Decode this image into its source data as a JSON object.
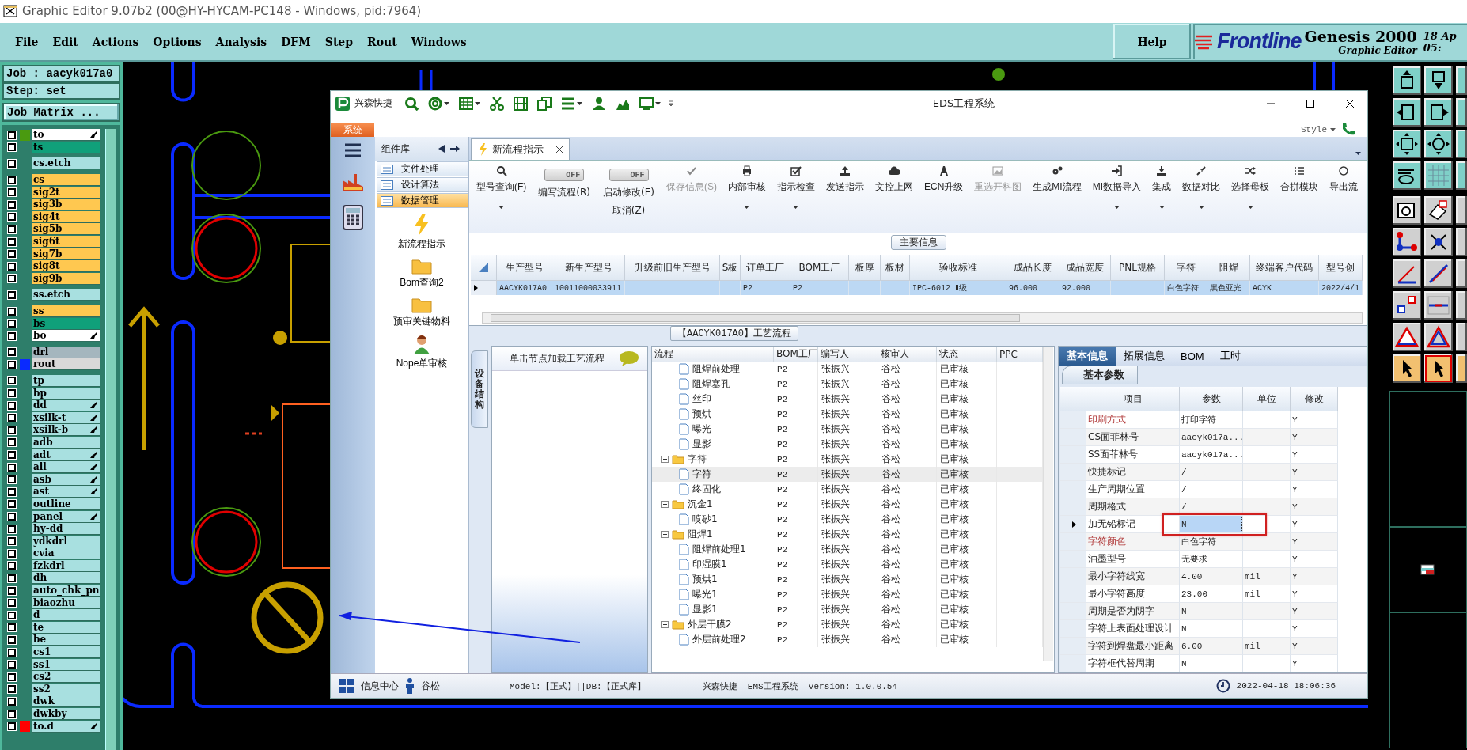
{
  "window": {
    "title": "Graphic Editor 9.07b2 (00@HY-HYCAM-PC148 - Windows, pid:7964)"
  },
  "menu": [
    {
      "label": "File"
    },
    {
      "label": "Edit"
    },
    {
      "label": "Actions"
    },
    {
      "label": "Options"
    },
    {
      "label": "Analysis"
    },
    {
      "label": "DFM"
    },
    {
      "label": "Step"
    },
    {
      "label": "Rout"
    },
    {
      "label": "Windows"
    }
  ],
  "help": "Help",
  "brand": {
    "logo": "Frontline",
    "product": "Genesis 2000",
    "subtitle": "Graphic Editor",
    "date": "18 Ap",
    "time": "05:"
  },
  "job": {
    "job": "Job : aacyk017a0",
    "step": "Step: set",
    "matrix_button": "Job Matrix ..."
  },
  "layer_groups": [
    {
      "layers": [
        {
          "name": "to",
          "color": "#ffffff",
          "swatch": {
            "color": "#4a9a10"
          },
          "pointer": true,
          "checked": false
        },
        {
          "name": "ts",
          "color": "#10a07a",
          "pointer": false,
          "checked": false
        }
      ]
    },
    {
      "layers": [
        {
          "name": "cs.etch",
          "color": "#a8e0e0",
          "pointer": false,
          "checked": false
        }
      ]
    },
    {
      "layers": [
        {
          "name": "cs",
          "color": "#ffc850",
          "pointer": false,
          "checked": false
        },
        {
          "name": "sig2t",
          "color": "#ffc850",
          "pointer": false,
          "checked": false
        },
        {
          "name": "sig3b",
          "color": "#ffc850",
          "pointer": false,
          "checked": false
        },
        {
          "name": "sig4t",
          "color": "#ffc850",
          "pointer": false,
          "checked": false
        },
        {
          "name": "sig5b",
          "color": "#ffc850",
          "pointer": false,
          "checked": false
        },
        {
          "name": "sig6t",
          "color": "#ffc850",
          "pointer": false,
          "checked": false
        },
        {
          "name": "sig7b",
          "color": "#ffc850",
          "pointer": false,
          "checked": false
        },
        {
          "name": "sig8t",
          "color": "#ffc850",
          "pointer": false,
          "checked": false
        },
        {
          "name": "sig9b",
          "color": "#ffc850",
          "pointer": false,
          "checked": false
        }
      ]
    },
    {
      "layers": [
        {
          "name": "ss.etch",
          "color": "#a8e0e0",
          "pointer": false,
          "checked": false
        }
      ]
    },
    {
      "layers": [
        {
          "name": "ss",
          "color": "#ffc850",
          "pointer": false,
          "checked": false
        },
        {
          "name": "bs",
          "color": "#10a07a",
          "pointer": false,
          "checked": false
        },
        {
          "name": "bo",
          "color": "#ffffff",
          "pointer": true,
          "checked": false
        }
      ]
    },
    {
      "layers": [
        {
          "name": "drl",
          "color": "#a4b6be",
          "pointer": false,
          "checked": false
        },
        {
          "name": "rout",
          "color": "#d8d8d8",
          "swatch": {
            "color": "#0a2aff"
          },
          "pointer": false,
          "checked": false
        }
      ]
    },
    {
      "layers": [
        {
          "name": "tp",
          "color": "#a8e0e0",
          "pointer": false,
          "checked": false
        },
        {
          "name": "bp",
          "color": "#a8e0e0",
          "pointer": false,
          "checked": false
        },
        {
          "name": "dd",
          "color": "#a8e0e0",
          "pointer": true,
          "checked": false
        },
        {
          "name": "xsilk-t",
          "color": "#a8e0e0",
          "pointer": true,
          "checked": false
        },
        {
          "name": "xsilk-b",
          "color": "#a8e0e0",
          "pointer": true,
          "checked": false
        },
        {
          "name": "adb",
          "color": "#a8e0e0",
          "pointer": false,
          "checked": false
        },
        {
          "name": "adt",
          "color": "#a8e0e0",
          "pointer": true,
          "checked": false
        },
        {
          "name": "all",
          "color": "#a8e0e0",
          "pointer": true,
          "checked": false
        },
        {
          "name": "asb",
          "color": "#a8e0e0",
          "pointer": true,
          "checked": false
        },
        {
          "name": "ast",
          "color": "#a8e0e0",
          "pointer": true,
          "checked": false
        },
        {
          "name": "outline",
          "color": "#a8e0e0",
          "pointer": false,
          "checked": false
        },
        {
          "name": "panel",
          "color": "#a8e0e0",
          "pointer": true,
          "checked": false
        },
        {
          "name": "hy-dd",
          "color": "#a8e0e0",
          "pointer": false,
          "checked": false
        },
        {
          "name": "ydkdrl",
          "color": "#a8e0e0",
          "pointer": false,
          "checked": false
        },
        {
          "name": "cvia",
          "color": "#a8e0e0",
          "pointer": false,
          "checked": false
        },
        {
          "name": "fzkdrl",
          "color": "#a8e0e0",
          "pointer": false,
          "checked": false
        },
        {
          "name": "dh",
          "color": "#a8e0e0",
          "pointer": false,
          "checked": false
        },
        {
          "name": "auto_chk_pn",
          "color": "#a8e0e0",
          "pointer": false,
          "checked": false
        },
        {
          "name": "biaozhu",
          "color": "#a8e0e0",
          "pointer": false,
          "checked": false
        },
        {
          "name": "d",
          "color": "#a8e0e0",
          "pointer": false,
          "checked": false
        },
        {
          "name": "te",
          "color": "#a8e0e0",
          "pointer": false,
          "checked": false
        },
        {
          "name": "be",
          "color": "#a8e0e0",
          "pointer": false,
          "checked": false
        },
        {
          "name": "cs1",
          "color": "#a8e0e0",
          "pointer": false,
          "checked": false
        },
        {
          "name": "ss1",
          "color": "#a8e0e0",
          "pointer": false,
          "checked": false
        },
        {
          "name": "cs2",
          "color": "#a8e0e0",
          "pointer": false,
          "checked": false
        },
        {
          "name": "ss2",
          "color": "#a8e0e0",
          "pointer": false,
          "checked": false
        },
        {
          "name": "dwk",
          "color": "#a8e0e0",
          "pointer": false,
          "checked": false
        },
        {
          "name": "dwkby",
          "color": "#a8e0e0",
          "pointer": false,
          "checked": false
        },
        {
          "name": "to.d",
          "color": "#a8e0e0",
          "swatch": {
            "color": "#ff0000"
          },
          "pointer": true,
          "checked": false
        }
      ]
    }
  ],
  "tool_palette": {
    "rows": [
      {
        "kind": "nav"
      },
      {
        "kind": "nav"
      },
      {
        "kind": "nav"
      },
      {
        "kind": "nav"
      },
      {
        "kind": "edit"
      },
      {
        "kind": "edit"
      },
      {
        "kind": "edit"
      },
      {
        "kind": "edit"
      },
      {
        "kind": "edit"
      },
      {
        "kind": "mode"
      }
    ]
  },
  "eds": {
    "brand": "兴森快捷",
    "title": "EDS工程系统",
    "system_tab": "系统",
    "style": "Style",
    "sidebar": {
      "header": "组件库",
      "groups": [
        {
          "label": "文件处理",
          "selected": false
        },
        {
          "label": "设计算法",
          "selected": false
        },
        {
          "label": "数据管理",
          "selected": true
        }
      ],
      "items": [
        {
          "label": "新流程指示"
        },
        {
          "label": "Bom查询2"
        },
        {
          "label": "预审关键物料"
        },
        {
          "label": "Nope单审核"
        }
      ]
    },
    "doc_tab": "新流程指示",
    "ribbon": [
      {
        "kind": "button",
        "label": "型号查询(F)",
        "dropdown": true,
        "disabled": false
      },
      {
        "kind": "toggle",
        "state": "OFF",
        "on": false,
        "label": "编写流程(R)"
      },
      {
        "kind": "toggle",
        "state": "OFF",
        "on": false,
        "label": "启动修改(E)",
        "label2": "取消(Z)"
      },
      {
        "kind": "button",
        "label": "保存信息(S)",
        "dropdown": false,
        "disabled": true
      },
      {
        "kind": "button",
        "label": "内部审核",
        "dropdown": true,
        "disabled": false
      },
      {
        "kind": "button",
        "label": "指示检查",
        "dropdown": true,
        "disabled": false
      },
      {
        "kind": "button",
        "label": "发送指示",
        "dropdown": false,
        "disabled": false
      },
      {
        "kind": "button",
        "label": "文控上网",
        "dropdown": false,
        "disabled": false
      },
      {
        "kind": "button",
        "label": "ECN升级",
        "dropdown": false,
        "disabled": false
      },
      {
        "kind": "button",
        "label": "重选开料图",
        "dropdown": false,
        "disabled": true
      },
      {
        "kind": "button",
        "label": "生成MI流程",
        "dropdown": false,
        "disabled": false
      },
      {
        "kind": "button",
        "label": "MI数据导入",
        "dropdown": true,
        "disabled": false
      },
      {
        "kind": "button",
        "label": "集成",
        "dropdown": true,
        "disabled": false
      },
      {
        "kind": "button",
        "label": "数据对比",
        "dropdown": true,
        "disabled": false
      },
      {
        "kind": "button",
        "label": "选择母板",
        "dropdown": true,
        "disabled": false
      },
      {
        "kind": "button",
        "label": "合拼模块",
        "dropdown": false,
        "disabled": false
      },
      {
        "kind": "button",
        "label": "导出流",
        "dropdown": false,
        "disabled": false
      }
    ],
    "main_info": {
      "title": "主要信息",
      "columns": [
        "生产型号",
        "新生产型号",
        "升级前旧生产型号",
        "S板",
        "订单工厂",
        "BOM工厂",
        "板厚",
        "板材",
        "验收标准",
        "成品长度",
        "成品宽度",
        "PNL规格",
        "字符",
        "阻焊",
        "终端客户代码",
        "型号创"
      ],
      "rows": [
        {
          "selected": true,
          "cells": [
            "AACYK017A0",
            "10011000033911",
            null,
            null,
            "P2",
            "P2",
            null,
            null,
            "IPC-6012 Ⅱ级",
            "96.000",
            "92.000",
            null,
            "白色字符",
            "黑色亚光",
            "ACYK",
            "2022/4/1"
          ]
        }
      ]
    },
    "process": {
      "title": "【AACYK017A0】工艺流程",
      "side_tab": "设备结构",
      "hint": "单击节点加载工艺流程",
      "columns": [
        "流程",
        "BOM工厂",
        "编写人",
        "核审人",
        "状态",
        "PPC"
      ],
      "tree": [
        {
          "children": [
            {
              "kind": "step",
              "name": "阻焊前处理",
              "bom": "P2",
              "author": "张振兴",
              "reviewer": "谷松",
              "status": "已审核",
              "selected": false
            },
            {
              "kind": "step",
              "name": "阻焊塞孔",
              "bom": "P2",
              "author": "张振兴",
              "reviewer": "谷松",
              "status": "已审核",
              "selected": false
            },
            {
              "kind": "step",
              "name": "丝印",
              "bom": "P2",
              "author": "张振兴",
              "reviewer": "谷松",
              "status": "已审核",
              "selected": false
            },
            {
              "kind": "step",
              "name": "预烘",
              "bom": "P2",
              "author": "张振兴",
              "reviewer": "谷松",
              "status": "已审核",
              "selected": false
            },
            {
              "kind": "step",
              "name": "曝光",
              "bom": "P2",
              "author": "张振兴",
              "reviewer": "谷松",
              "status": "已审核",
              "selected": false
            },
            {
              "kind": "step",
              "name": "显影",
              "bom": "P2",
              "author": "张振兴",
              "reviewer": "谷松",
              "status": "已审核",
              "selected": false
            }
          ]
        },
        {
          "kind": "folder",
          "name": "字符",
          "bom": "P2",
          "author": "张振兴",
          "reviewer": "谷松",
          "status": "已审核",
          "selected": false,
          "expanded": true,
          "children": [
            {
              "kind": "step",
              "name": "字符",
              "bom": "P2",
              "author": "张振兴",
              "reviewer": "谷松",
              "status": "已审核",
              "selected": true
            },
            {
              "kind": "step",
              "name": "终固化",
              "bom": "P2",
              "author": "张振兴",
              "reviewer": "谷松",
              "status": "已审核",
              "selected": false
            }
          ]
        },
        {
          "kind": "folder",
          "name": "沉金1",
          "bom": "P2",
          "author": "张振兴",
          "reviewer": "谷松",
          "status": "已审核",
          "selected": false,
          "expanded": true,
          "children": [
            {
              "kind": "step",
              "name": "喷砂1",
              "bom": "P2",
              "author": "张振兴",
              "reviewer": "谷松",
              "status": "已审核",
              "selected": false
            }
          ]
        },
        {
          "kind": "folder",
          "name": "阻焊1",
          "bom": "P2",
          "author": "张振兴",
          "reviewer": "谷松",
          "status": "已审核",
          "selected": false,
          "expanded": true,
          "children": [
            {
              "kind": "step",
              "name": "阻焊前处理1",
              "bom": "P2",
              "author": "张振兴",
              "reviewer": "谷松",
              "status": "已审核",
              "selected": false
            },
            {
              "kind": "step",
              "name": "印湿膜1",
              "bom": "P2",
              "author": "张振兴",
              "reviewer": "谷松",
              "status": "已审核",
              "selected": false
            },
            {
              "kind": "step",
              "name": "预烘1",
              "bom": "P2",
              "author": "张振兴",
              "reviewer": "谷松",
              "status": "已审核",
              "selected": false
            },
            {
              "kind": "step",
              "name": "曝光1",
              "bom": "P2",
              "author": "张振兴",
              "reviewer": "谷松",
              "status": "已审核",
              "selected": false
            },
            {
              "kind": "step",
              "name": "显影1",
              "bom": "P2",
              "author": "张振兴",
              "reviewer": "谷松",
              "status": "已审核",
              "selected": false
            }
          ]
        },
        {
          "kind": "folder",
          "name": "外层干膜2",
          "bom": "P2",
          "author": "张振兴",
          "reviewer": "谷松",
          "status": "已审核",
          "selected": false,
          "expanded": true,
          "children": [
            {
              "kind": "step",
              "name": "外层前处理2",
              "bom": "P2",
              "author": "张振兴",
              "reviewer": "谷松",
              "status": "已审核",
              "selected": false
            }
          ]
        }
      ]
    },
    "params": {
      "tabs": [
        {
          "label": "基本信息",
          "selected": true
        },
        {
          "label": "拓展信息",
          "selected": false
        },
        {
          "label": "BOM",
          "selected": false
        },
        {
          "label": "工时",
          "selected": false
        }
      ],
      "subtab": "基本参数",
      "columns": [
        "项目",
        "参数",
        "单位",
        "修改"
      ],
      "rows": [
        {
          "item": "印刷方式",
          "value": "打印字符",
          "modify": "Y",
          "required": true,
          "selected": false
        },
        {
          "item": "CS面菲林号",
          "value": "aacyk017a...",
          "modify": "Y",
          "required": false,
          "selected": false
        },
        {
          "item": "SS面菲林号",
          "value": "aacyk017a...",
          "modify": "Y",
          "required": false,
          "selected": false
        },
        {
          "item": "快捷标记",
          "value": "/",
          "modify": "Y",
          "required": false,
          "selected": false
        },
        {
          "item": "生产周期位置",
          "value": "/",
          "modify": "Y",
          "required": false,
          "selected": false
        },
        {
          "item": "周期格式",
          "value": "/",
          "modify": "Y",
          "required": false,
          "selected": false
        },
        {
          "item": "加无铅标记",
          "value": "N",
          "modify": "Y",
          "required": false,
          "selected": true
        },
        {
          "item": "字符颜色",
          "value": "白色字符",
          "modify": "Y",
          "required": true,
          "selected": false
        },
        {
          "item": "油墨型号",
          "value": "无要求",
          "modify": "Y",
          "required": false,
          "selected": false
        },
        {
          "item": "最小字符线宽",
          "value": "4.00",
          "unit": "mil",
          "modify": "Y",
          "required": false,
          "selected": false
        },
        {
          "item": "最小字符高度",
          "value": "23.00",
          "unit": "mil",
          "modify": "Y",
          "required": false,
          "selected": false
        },
        {
          "item": "周期是否为阴字",
          "value": "N",
          "modify": "Y",
          "required": false,
          "selected": false
        },
        {
          "item": "字符上表面处理设计",
          "value": "N",
          "modify": "Y",
          "required": false,
          "selected": false
        },
        {
          "item": "字符到焊盘最小距离",
          "value": "6.00",
          "unit": "mil",
          "modify": "Y",
          "required": false,
          "selected": false
        },
        {
          "item": "字符框代替周期",
          "value": "N",
          "modify": "Y",
          "required": false,
          "selected": false
        }
      ]
    },
    "status_bar": {
      "info": "信息中心",
      "user": "谷松",
      "model": "Model:【正式】||DB:【正式库】",
      "product": "兴森快捷  EMS工程系统  Version: 1.0.0.54",
      "datetime": "2022-04-18 18:06:36"
    }
  }
}
